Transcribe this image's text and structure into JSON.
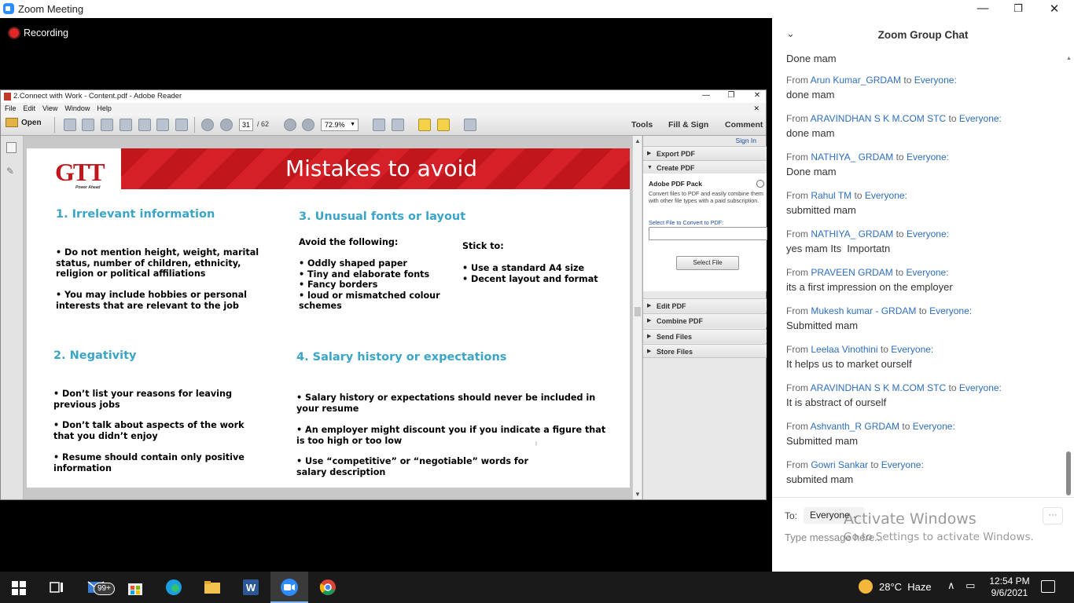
{
  "zoom": {
    "window_title": "Zoom Meeting",
    "recording": "Recording",
    "controls": {
      "minimize": "—",
      "restore": "❐",
      "close": "✕"
    }
  },
  "reader": {
    "title": "2.Connect with Work - Content.pdf - Adobe Reader",
    "menu": [
      "File",
      "Edit",
      "View",
      "Window",
      "Help"
    ],
    "toolbar": {
      "open": "Open",
      "page": "31",
      "page_total": "/ 62",
      "zoom": "72.9%",
      "tools": "Tools",
      "fill_sign": "Fill & Sign",
      "comment": "Comment"
    },
    "task_pane": {
      "sign_in": "Sign In",
      "export_pdf": "Export PDF",
      "create_pdf": "Create PDF",
      "pack_title": "Adobe PDF Pack",
      "pack_desc": "Convert files to PDF and easily combine them with other file types with a paid subscription.",
      "select_label": "Select File to Convert to PDF:",
      "select_button": "Select File",
      "edit_pdf": "Edit PDF",
      "combine_pdf": "Combine PDF",
      "send_files": "Send Files",
      "store_files": "Store Files"
    },
    "slide": {
      "title": "Mistakes to avoid",
      "logo_text": "GTT",
      "logo_tagline": "Power Ahead",
      "sec1_head": "1. Irrelevant information",
      "sec1_b1": "• Do not mention height, weight, marital status, number of children, ethnicity, religion or political affiliations",
      "sec1_b2": "• You may include hobbies or personal interests that are relevant to the job",
      "sec2_head": "2. Negativity",
      "sec2_b1": "• Don’t list your reasons for leaving previous jobs",
      "sec2_b2": "• Don’t talk about aspects of the work that you didn’t enjoy",
      "sec2_b3": "• Resume should contain only positive information",
      "sec3_head": "3. Unusual fonts or layout",
      "sec3_avoid": "Avoid the following:",
      "sec3_avoid_list": "• Oddly shaped paper\n• Tiny and elaborate fonts\n• Fancy borders\n• loud or mismatched colour schemes",
      "sec3_stick": "Stick to:",
      "sec3_stick_list": "• Use a standard A4 size\n• Decent layout and format",
      "sec4_head": "4. Salary history or expectations",
      "sec4_b1": "• Salary history or expectations should never be included in your resume",
      "sec4_b2": "• An employer might discount you if you indicate a figure that is too high or too low",
      "sec4_b3": "• Use “competitive” or “negotiable” words for salary description"
    }
  },
  "chat": {
    "title": "Zoom Group Chat",
    "from_word": "From",
    "to_word": "to",
    "messages": [
      {
        "sender": "",
        "to": "",
        "text": "Done mam"
      },
      {
        "sender": "Arun Kumar_GRDAM",
        "to": "Everyone:",
        "text": "done mam"
      },
      {
        "sender": "ARAVINDHAN  S K M.COM STC",
        "to": "Everyone:",
        "text": "done mam"
      },
      {
        "sender": "NATHIYA_ GRDAM",
        "to": "Everyone:",
        "text": "Done mam"
      },
      {
        "sender": "Rahul TM",
        "to": "Everyone:",
        "text": "submitted mam"
      },
      {
        "sender": "NATHIYA_ GRDAM",
        "to": "Everyone:",
        "text": "yes mam Its  Importatn"
      },
      {
        "sender": "PRAVEEN GRDAM",
        "to": "Everyone:",
        "text": "its a first impression on the employer"
      },
      {
        "sender": "Mukesh kumar - GRDAM",
        "to": "Everyone:",
        "text": "Submitted mam"
      },
      {
        "sender": "Leelaa Vinothini",
        "to": "Everyone:",
        "text": "It helps us to market ourself"
      },
      {
        "sender": "ARAVINDHAN  S K M.COM STC",
        "to": "Everyone:",
        "text": "It is abstract of ourself"
      },
      {
        "sender": "Ashvanth_R GRDAM",
        "to": "Everyone:",
        "text": "Submitted mam"
      },
      {
        "sender": "Gowri Sankar",
        "to": "Everyone:",
        "text": "submited mam"
      }
    ],
    "input": {
      "to_label": "To:",
      "recipient": "Everyone",
      "placeholder": "Type message here...",
      "more": "···"
    }
  },
  "activate_windows": {
    "line1": "Activate Windows",
    "line2": "Go to Settings to activate Windows."
  },
  "taskbar": {
    "mail_badge": "99+",
    "weather": "28°C  Haze",
    "time": "12:54 PM",
    "date": "9/6/2021"
  }
}
